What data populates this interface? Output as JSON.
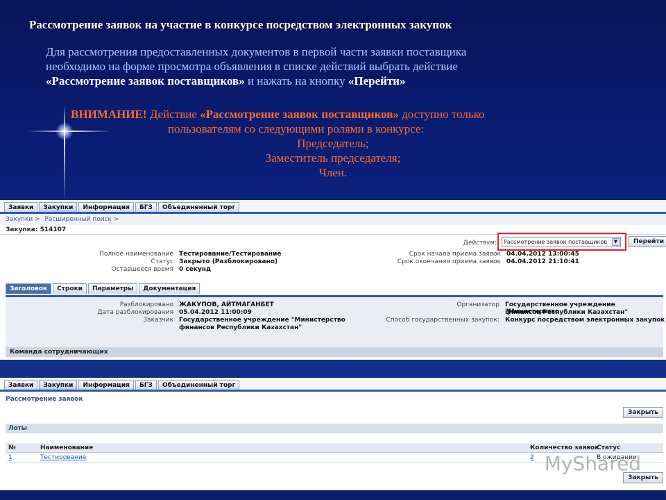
{
  "slide": {
    "title": "Рассмотрение заявок на участие в конкурсе посредством электронных закупок",
    "para_line1": "Для рассмотрения предоставленных документов в первой части заявки поставщика",
    "para_line2": "необходимо на форме просмотра объявления в списке действий выбрать действие",
    "para_action": "«Рассмотрение заявок поставщиков»",
    "para_mid": " и нажать на кнопку ",
    "para_button": "«Перейти»",
    "warn_label": "ВНИМАНИЕ!",
    "warn_text1": "Действие ",
    "warn_action": "«Рассмотрение заявок поставщиков»",
    "warn_text2": " доступно только",
    "warn_line2": "пользователям со следующими ролями в конкурсе:",
    "roles": [
      "Председатель;",
      "Заместитель председателя;",
      "Член."
    ]
  },
  "shot1": {
    "tabs": [
      "Заявки",
      "Закупки",
      "Информация",
      "БГЗ",
      "Объединенный торг"
    ],
    "active_tab": "Закупки",
    "breadcrumb": [
      "Закупки >",
      "Расширенный поиск >"
    ],
    "purchase": "Закупка: 514107",
    "fields_left": [
      {
        "label": "Полное наименование",
        "value": "Тестирование/Тестирование"
      },
      {
        "label": "Статус",
        "value": "Закрыто (Разблокировано)"
      },
      {
        "label": "Оставшееся время",
        "value": "0 секунд"
      }
    ],
    "action_label": "Действия:",
    "action_selected": "Рассмотрение заявок поставщиков",
    "go_button": "Перейти",
    "fields_right": [
      {
        "label": "Срок начала приема заявок",
        "value": "04.04.2012 13:00:45"
      },
      {
        "label": "Срок окончания приема заявок",
        "value": "04.04.2012 21:10:41"
      }
    ],
    "subtabs": [
      "Заголовок",
      "Строки",
      "Параметры",
      "Документация"
    ],
    "header_left": [
      {
        "label": "Разблокировано",
        "value": "ЖАКУПОВ, АЙТМАГАНБЕТ"
      },
      {
        "label": "Дата разблокирования",
        "value": "05.04.2012 11:00:09"
      },
      {
        "label": "Заказчик",
        "value": "Государственное учреждение \"Министерство"
      },
      {
        "label": "",
        "value": "финансов Республики Казахстан\""
      }
    ],
    "header_right": [
      {
        "label": "Организатор",
        "value": "Государственное учреждение \"Министерство"
      },
      {
        "label": "",
        "value": "финансов Республики Казахстан\""
      },
      {
        "label": "Способ государственных закупок:",
        "value": "Конкурс посредством электронных закупок"
      }
    ],
    "team_header": "Команда сотрудничающих"
  },
  "shot2": {
    "tabs": [
      "Заявки",
      "Закупки",
      "Информация",
      "БГЗ",
      "Объединенный торг"
    ],
    "active_tab": "Закупки",
    "page_title": "Рассмотрение заявок",
    "close_button": "Закрыть",
    "section": "Лоты",
    "columns": [
      "№",
      "Наименование",
      "Количество заявок",
      "Статус"
    ],
    "rows": [
      {
        "num": "1",
        "name": "Тестирование",
        "count": "2",
        "status": "В ожидании"
      }
    ],
    "watermark": "MyShared"
  }
}
